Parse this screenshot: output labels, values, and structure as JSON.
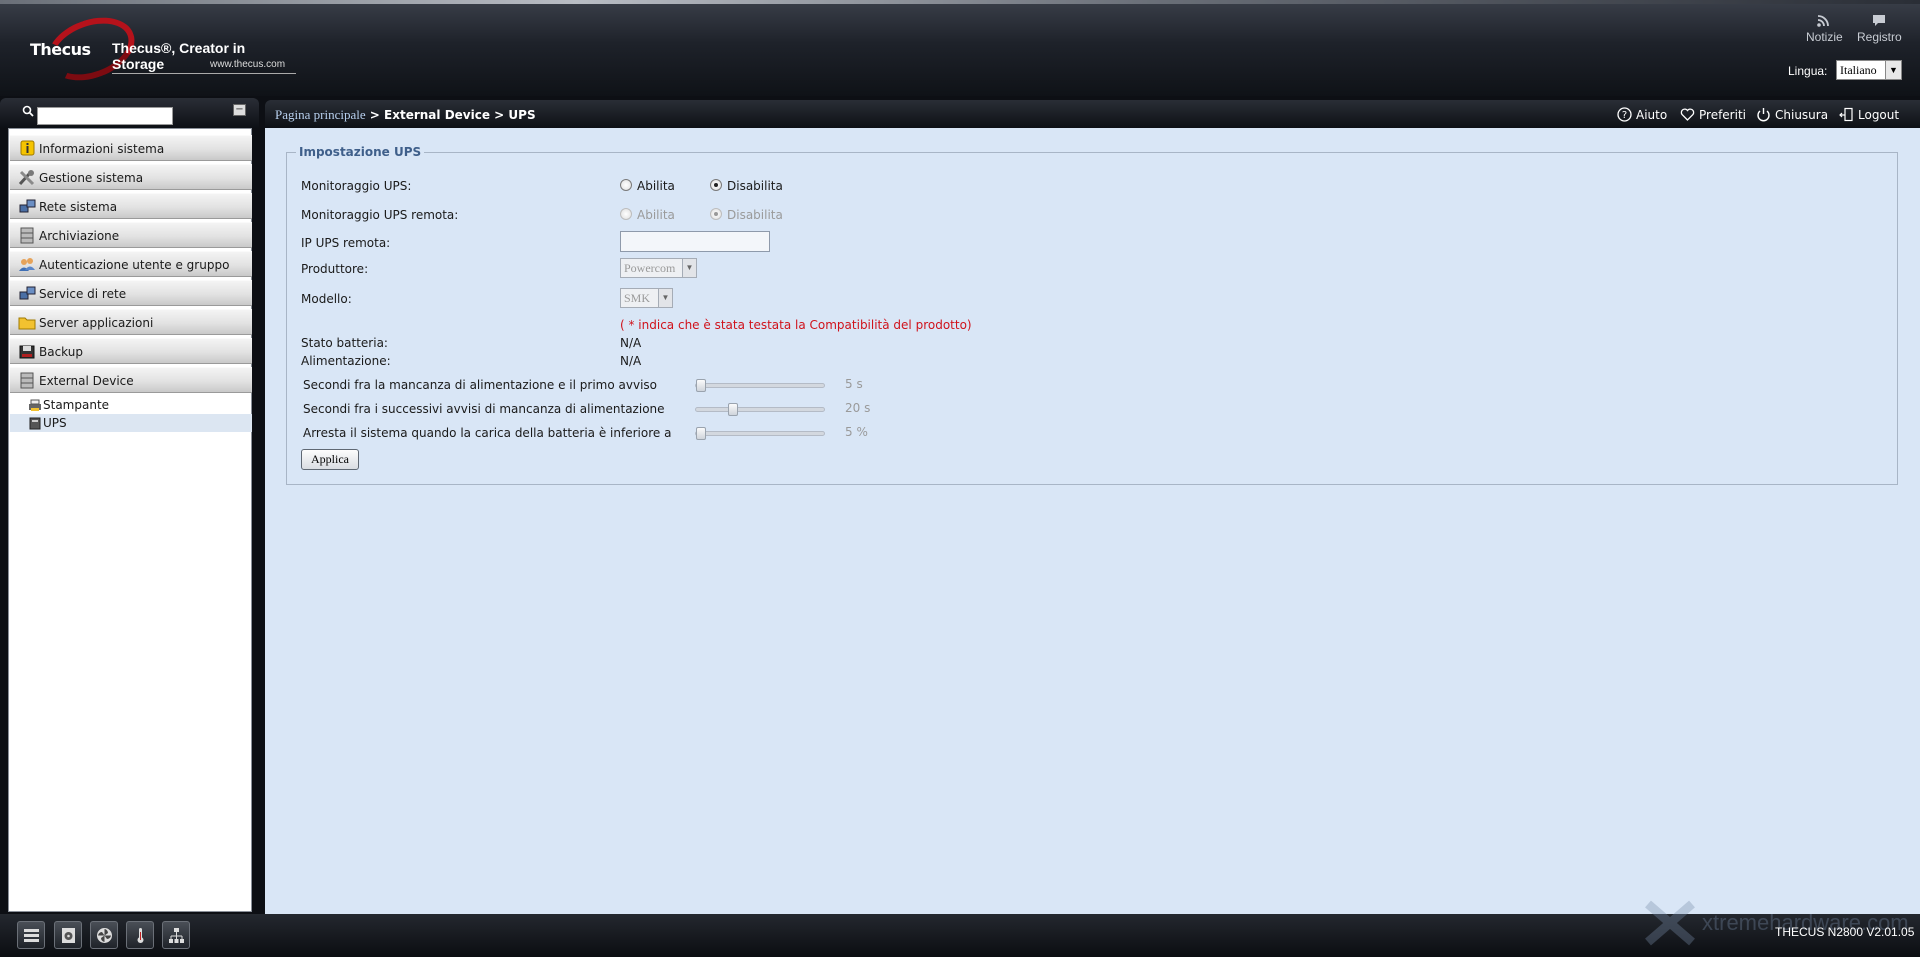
{
  "header": {
    "logo_word": "Thecus",
    "logo_tagline": "Thecus®, Creator in Storage",
    "logo_url": "www.thecus.com",
    "news_label": "Notizie",
    "log_label": "Registro",
    "language_label": "Lingua:",
    "language_value": "Italiano"
  },
  "sidebar": {
    "search_placeholder": "",
    "items": [
      {
        "label": "Informazioni sistema",
        "icon": "info-icon"
      },
      {
        "label": "Gestione sistema",
        "icon": "tools-icon"
      },
      {
        "label": "Rete sistema",
        "icon": "network-icon"
      },
      {
        "label": "Archiviazione",
        "icon": "storage-icon"
      },
      {
        "label": "Autenticazione utente e gruppo",
        "icon": "users-icon"
      },
      {
        "label": "Service di rete",
        "icon": "network-service-icon"
      },
      {
        "label": "Server applicazioni",
        "icon": "folder-icon"
      },
      {
        "label": "Backup",
        "icon": "backup-icon"
      },
      {
        "label": "External Device",
        "icon": "external-device-icon"
      }
    ],
    "subitems": [
      {
        "label": "Stampante",
        "icon": "printer-icon"
      },
      {
        "label": "UPS",
        "icon": "ups-icon",
        "active": true
      }
    ]
  },
  "breadcrumb": {
    "home": "Pagina principale",
    "sep": " > ",
    "section": "External Device",
    "page": "UPS"
  },
  "toplinks": {
    "help": "Aiuto",
    "favorites": "Preferiti",
    "shutdown": "Chiusura",
    "logout": "Logout"
  },
  "form": {
    "legend": "Impostazione UPS",
    "ups_monitoring_label": "Monitoraggio UPS:",
    "remote_monitoring_label": "Monitoraggio UPS remota:",
    "enable": "Abilita",
    "disable": "Disabilita",
    "remote_ip_label": "IP UPS remota:",
    "remote_ip_value": "",
    "manufacturer_label": "Produttore:",
    "manufacturer_value": "Powercom",
    "model_label": "Modello:",
    "model_value": "SMK",
    "note": "( * indica che è stata testata la Compatibilità del prodotto)",
    "battery_status_label": "Stato batteria:",
    "battery_status_value": "N/A",
    "power_label": "Alimentazione:",
    "power_value": "N/A",
    "slider1_label": "Secondi fra la mancanza di alimentazione e il primo avviso",
    "slider1_value": "5 s",
    "slider2_label": "Secondi fra i successivi avvisi di mancanza di alimentazione",
    "slider2_value": "20 s",
    "slider3_label": "Arresta il sistema quando la carica della batteria è inferiore a",
    "slider3_value": "5 %",
    "apply": "Applica"
  },
  "footer": {
    "version": "THECUS N2800 V2.01.05",
    "watermark": "xtremehardware.com"
  },
  "colors": {
    "accent": "#3f5f8a",
    "note_red": "#d0121b",
    "content_bg": "#d9e6f6"
  }
}
